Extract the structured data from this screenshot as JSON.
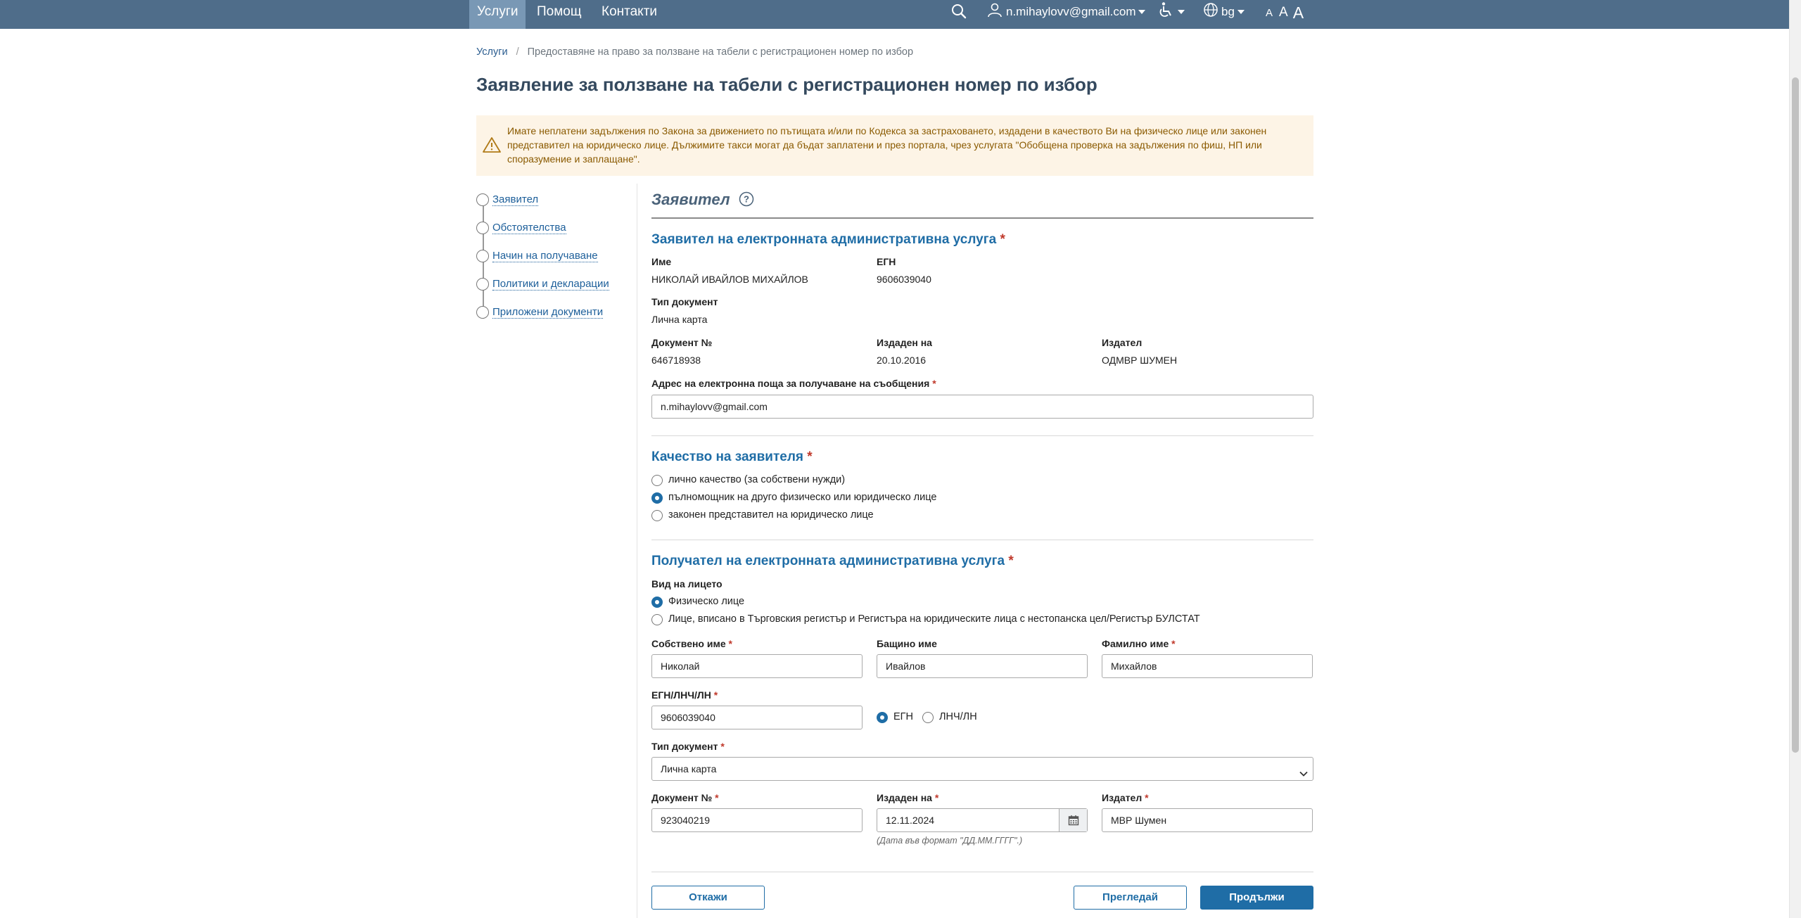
{
  "nav": {
    "items": [
      "Услуги",
      "Помощ",
      "Контакти"
    ],
    "user_email": "n.mihaylovv@gmail.com",
    "language": "bg",
    "font_sizes": [
      "A",
      "A",
      "A"
    ]
  },
  "breadcrumb": {
    "home": "Услуги",
    "sep": "/",
    "current": "Предоставяне на право за ползване на табели с регистрационен номер по избор"
  },
  "page_title": "Заявление за ползване на табели с регистрационен номер по избор",
  "alert": {
    "text": "Имате неплатени задължения по Закона за движението по пътищата и/или по Кодекса за застраховането, издадени в качеството Ви на физическо лице или законен представител на юридическо лице. Дължимите такси могат да бъдат заплатени и през портала, чрез услугата \"Обобщена проверка на задължения по фиш, НП или споразумение и заплащане\"."
  },
  "steps": [
    "Заявител",
    "Обстоятелства",
    "Начин на получаване",
    "Политики и декларации",
    "Приложени документи"
  ],
  "section_title": "Заявител",
  "applicant": {
    "heading": "Заявител на електронната административна услуга",
    "name_label": "Име",
    "name": "НИКОЛАЙ ИВАЙЛОВ МИХАЙЛОВ",
    "egn_label": "ЕГН",
    "egn": "9606039040",
    "doc_type_label": "Тип документ",
    "doc_type": "Лична карта",
    "doc_no_label": "Документ №",
    "doc_no": "646718938",
    "issued_label": "Издаден на",
    "issued": "20.10.2016",
    "issuer_label": "Издател",
    "issuer": "ОДМВР ШУМЕН",
    "email_label": "Адрес на електронна поща за получаване на съобщения",
    "email": "n.mihaylovv@gmail.com"
  },
  "capacity": {
    "heading": "Качество на заявителя",
    "options": [
      "лично качество (за собствени нужди)",
      "пълномощник на друго физическо или юридическо лице",
      "законен представител на юридическо лице"
    ],
    "selected_index": 1
  },
  "recipient": {
    "heading": "Получател на електронната административна услуга",
    "person_type_label": "Вид на лицето",
    "person_types": [
      "Физическо лице",
      "Лице, вписано в Търговския регистър и Регистъра на юридическите лица с нестопанска цел/Регистър БУЛСТАТ"
    ],
    "first_name_label": "Собствено име",
    "first_name": "Николай",
    "middle_name_label": "Бащино име",
    "middle_name": "Ивайлов",
    "last_name_label": "Фамилно име",
    "last_name": "Михайлов",
    "id_label": "ЕГН/ЛНЧ/ЛН",
    "id_value": "9606039040",
    "id_types": [
      "ЕГН",
      "ЛНЧ/ЛН"
    ],
    "doc_type_label": "Тип документ",
    "doc_type": "Лична карта",
    "doc_no_label": "Документ №",
    "doc_no": "923040219",
    "issued_label": "Издаден на",
    "issued": "12.11.2024",
    "date_hint": "(Дата във формат \"ДД.ММ.ГГГГ\".)",
    "issuer_label": "Издател",
    "issuer": "МВР Шумен"
  },
  "buttons": {
    "cancel": "Откажи",
    "review": "Прегледай",
    "continue": "Продължи"
  },
  "colors": {
    "nav_bg": "#4f6d8a",
    "accent": "#1f6da6",
    "alert_bg": "#fdf4e6",
    "required": "#c0392b"
  }
}
